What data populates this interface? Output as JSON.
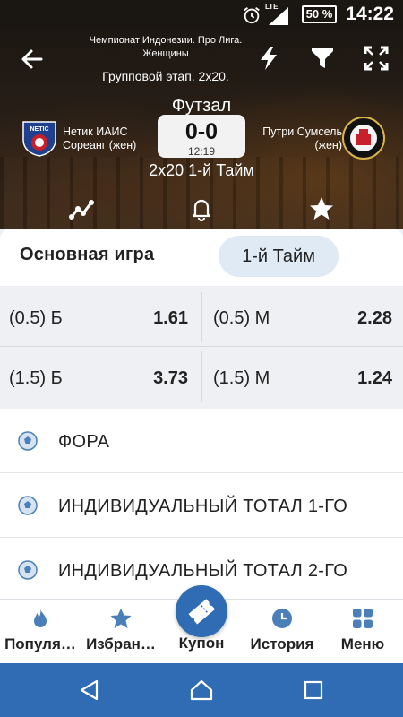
{
  "status_bar": {
    "time": "14:22",
    "battery": "50 %",
    "network": "LTE",
    "icons": [
      "alarm-icon",
      "signal-icon",
      "battery-icon"
    ]
  },
  "match": {
    "league": "Чемпионат Индонезии. Про Лига. Женщины",
    "stage": "Групповой этап. 2х20.",
    "sport": "Футзал",
    "home_team": {
      "line1": "Нетик ИАИС",
      "line2": "Сореанг (жен)",
      "logo_text": "NETIC"
    },
    "away_team": {
      "line1": "Путри Сумсель",
      "line2": "(жен)"
    },
    "score": "0-0",
    "clock": "12:19",
    "period": "2х20 1-й Тайм"
  },
  "tabs": {
    "main": "Основная игра",
    "half": "1-й Тайм",
    "active": "half"
  },
  "odds": [
    {
      "label": "(0.5) Б",
      "value": "1.61"
    },
    {
      "label": "(0.5) М",
      "value": "2.28"
    },
    {
      "label": "(1.5) Б",
      "value": "3.73"
    },
    {
      "label": "(1.5) М",
      "value": "1.24"
    }
  ],
  "markets": [
    {
      "label": "ФОРА",
      "icon": "futsal-ball-icon"
    },
    {
      "label": "ИНДИВИДУАЛЬНЫЙ ТОТАЛ 1-ГО",
      "icon": "futsal-ball-icon"
    },
    {
      "label": "ИНДИВИДУАЛЬНЫЙ ТОТАЛ 2-ГО",
      "icon": "futsal-ball-icon"
    }
  ],
  "bottom_nav": {
    "popular": "Популя…",
    "favorites": "Избран…",
    "coupon": "Купон",
    "history": "История",
    "menu": "Меню"
  },
  "colors": {
    "accent": "#2f6cb3",
    "icon_blue": "#4a7fb8",
    "tab_active_bg": "#dfeaf5"
  }
}
